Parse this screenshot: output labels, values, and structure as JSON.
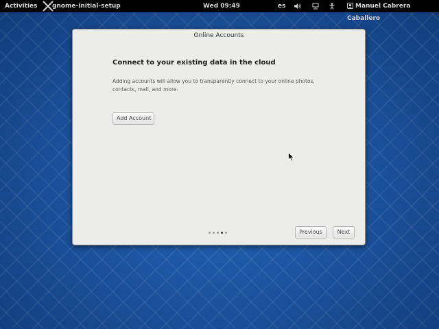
{
  "topbar": {
    "activities": "Activities",
    "app_name": "gnome-initial-setup",
    "clock": "Wed 09:49",
    "language": "es",
    "user": "Manuel Cabrera Caballero",
    "icons": [
      "app-x-icon",
      "volume-icon",
      "network-icon",
      "accessibility-icon",
      "user-icon"
    ]
  },
  "dialog": {
    "title": "Online Accounts",
    "heading": "Connect to your existing data in the cloud",
    "description": "Adding accounts will allow you to transparently connect to your online photos, contacts, mail, and more.",
    "add_account_label": "Add Account",
    "previous_label": "Previous",
    "next_label": "Next",
    "page_indicator": {
      "total": 5,
      "current": 4
    }
  }
}
